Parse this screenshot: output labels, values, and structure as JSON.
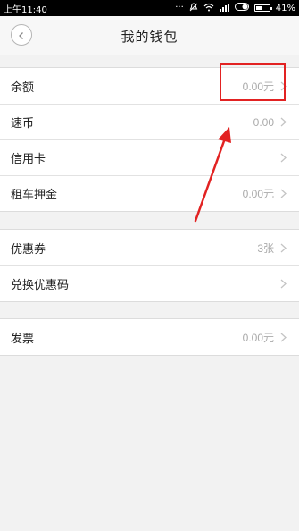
{
  "status_bar": {
    "time": "上午11:40",
    "battery": "41%",
    "battery_level": 0.41,
    "icons": [
      "signal-dots-icon",
      "mute-icon",
      "wifi-icon",
      "signal-icon",
      "toggle-icon",
      "battery-icon"
    ]
  },
  "header": {
    "title": "我的钱包",
    "back_icon": "chevron-left-icon"
  },
  "groups": [
    {
      "rows": [
        {
          "label": "余额",
          "value": "0.00元"
        },
        {
          "label": "速币",
          "value": "0.00"
        },
        {
          "label": "信用卡",
          "value": ""
        },
        {
          "label": "租车押金",
          "value": "0.00元"
        }
      ]
    },
    {
      "rows": [
        {
          "label": "优惠券",
          "value": "3张"
        },
        {
          "label": "兑换优惠码",
          "value": ""
        }
      ]
    },
    {
      "rows": [
        {
          "label": "发票",
          "value": "0.00元"
        }
      ]
    }
  ],
  "annotation": {
    "color": "#e22222",
    "target": "balance-value"
  }
}
